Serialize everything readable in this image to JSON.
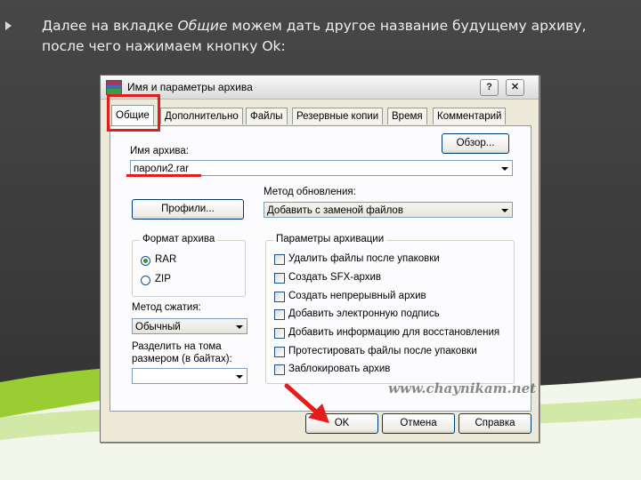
{
  "slide": {
    "bullet_pre": "Далее на вкладке ",
    "bullet_em": "Общие",
    "bullet_post": " можем дать другое название будущему архиву, после чего нажимаем кнопку Ok:"
  },
  "window": {
    "title": "Имя и параметры архива",
    "help_glyph": "?",
    "close_glyph": "✕"
  },
  "tabs": [
    "Общие",
    "Дополнительно",
    "Файлы",
    "Резервные копии",
    "Время",
    "Комментарий"
  ],
  "general": {
    "archive_name_label": "Имя архива:",
    "archive_name_value": "пароли2.rar",
    "browse_button": "Обзор...",
    "update_method_label": "Метод обновления:",
    "update_method_value": "Добавить с заменой файлов",
    "profiles_button": "Профили...",
    "format_group": "Формат архива",
    "format_rar": "RAR",
    "format_zip": "ZIP",
    "compression_label": "Метод сжатия:",
    "compression_value": "Обычный",
    "split_label_1": "Разделить на тома",
    "split_label_2": "размером (в байтах):",
    "split_value": "",
    "options_group": "Параметры архивации",
    "options": [
      "Удалить файлы после упаковки",
      "Создать SFX-архив",
      "Создать непрерывный архив",
      "Добавить электронную подпись",
      "Добавить информацию для восстановления",
      "Протестировать файлы после упаковки",
      "Заблокировать архив"
    ]
  },
  "buttons": {
    "ok": "OK",
    "cancel": "Отмена",
    "help": "Справка"
  },
  "watermark": "www.chaynikam.net",
  "colors": {
    "annotation": "#e51c1c",
    "accent_green": "#9acd32"
  }
}
